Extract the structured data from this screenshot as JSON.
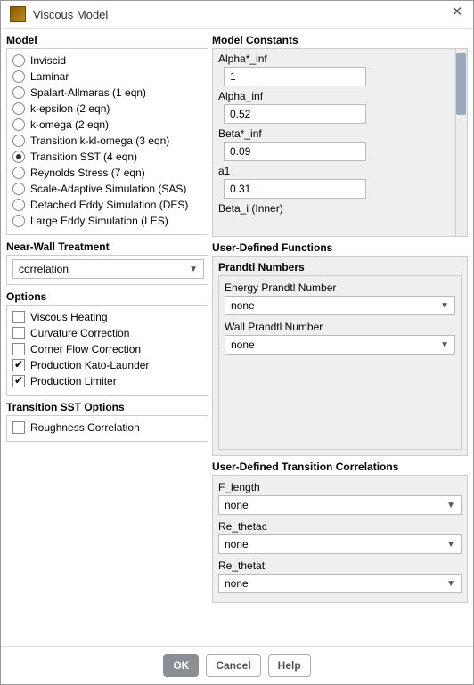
{
  "window": {
    "title": "Viscous Model"
  },
  "model": {
    "title": "Model",
    "options": [
      {
        "label": "Inviscid",
        "selected": false
      },
      {
        "label": "Laminar",
        "selected": false
      },
      {
        "label": "Spalart-Allmaras (1 eqn)",
        "selected": false
      },
      {
        "label": "k-epsilon (2 eqn)",
        "selected": false
      },
      {
        "label": "k-omega (2 eqn)",
        "selected": false
      },
      {
        "label": "Transition k-kl-omega (3 eqn)",
        "selected": false
      },
      {
        "label": "Transition SST (4 eqn)",
        "selected": true
      },
      {
        "label": "Reynolds Stress (7 eqn)",
        "selected": false
      },
      {
        "label": "Scale-Adaptive Simulation (SAS)",
        "selected": false
      },
      {
        "label": "Detached Eddy Simulation (DES)",
        "selected": false
      },
      {
        "label": "Large Eddy Simulation (LES)",
        "selected": false
      }
    ]
  },
  "near_wall": {
    "title": "Near-Wall Treatment",
    "value": "correlation"
  },
  "options": {
    "title": "Options",
    "items": [
      {
        "label": "Viscous Heating",
        "checked": false
      },
      {
        "label": "Curvature Correction",
        "checked": false
      },
      {
        "label": "Corner Flow Correction",
        "checked": false
      },
      {
        "label": "Production Kato-Launder",
        "checked": true
      },
      {
        "label": "Production Limiter",
        "checked": true
      }
    ]
  },
  "tsst_options": {
    "title": "Transition SST Options",
    "items": [
      {
        "label": "Roughness Correlation",
        "checked": false
      }
    ]
  },
  "model_constants": {
    "title": "Model Constants",
    "items": [
      {
        "label": "Alpha*_inf",
        "value": "1"
      },
      {
        "label": "Alpha_inf",
        "value": "0.52"
      },
      {
        "label": "Beta*_inf",
        "value": "0.09"
      },
      {
        "label": "a1",
        "value": "0.31"
      },
      {
        "label": "Beta_i (Inner)",
        "value": ""
      }
    ]
  },
  "udf": {
    "title": "User-Defined Functions",
    "prandtl_title": "Prandtl Numbers",
    "fields": [
      {
        "label": "Energy Prandtl Number",
        "value": "none"
      },
      {
        "label": "Wall Prandtl Number",
        "value": "none"
      }
    ]
  },
  "utc": {
    "title": "User-Defined Transition Correlations",
    "fields": [
      {
        "label": "F_length",
        "value": "none"
      },
      {
        "label": "Re_thetac",
        "value": "none"
      },
      {
        "label": "Re_thetat",
        "value": "none"
      }
    ]
  },
  "footer": {
    "ok": "OK",
    "cancel": "Cancel",
    "help": "Help"
  }
}
